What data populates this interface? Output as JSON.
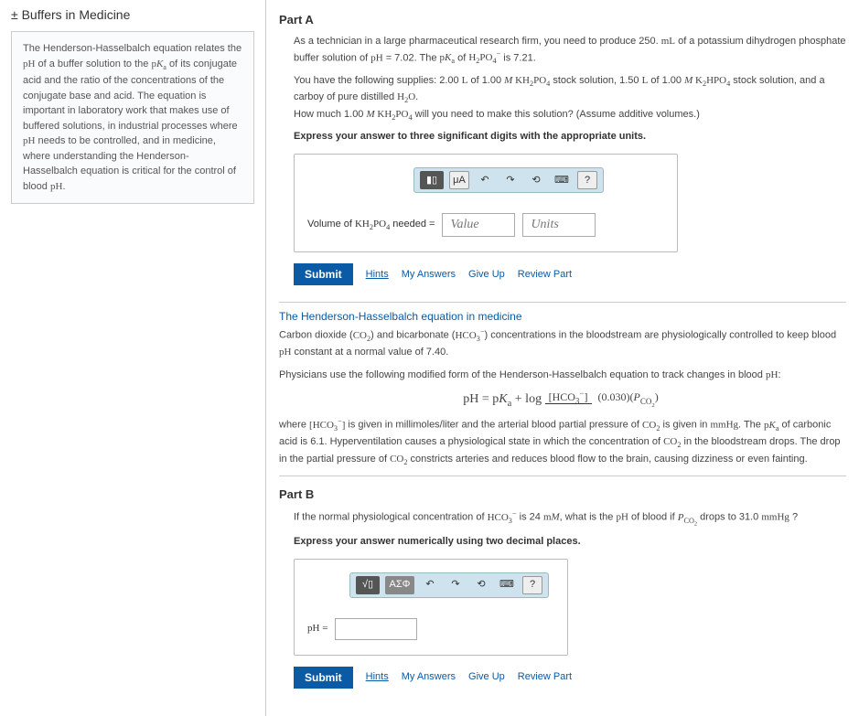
{
  "left": {
    "title": "± Buffers in Medicine",
    "box_html": "The Henderson-Hasselbalch equation relates the <span class='chem'>pH</span> of a buffer solution to the <span class='chem'>p<i>K</i><sub>a</sub></span> of its conjugate acid and the ratio of the concentrations of the conjugate base and acid. The equation is important in laboratory work that makes use of buffered solutions, in industrial processes where <span class='chem'>pH</span> needs to be controlled, and in medicine, where understanding the Henderson-Hasselbalch equation is critical for the control of blood <span class='chem'>pH</span>."
  },
  "partA": {
    "title": "Part A",
    "p1": "As a technician in a large pharmaceutical research firm, you need to produce 250. <span class='chem'>mL</span> of a potassium dihydrogen phosphate buffer solution of <span class='chem'>pH</span> = 7.02. The <span class='chem'>p<i>K</i><sub>a</sub></span> of <span class='chem'>H<sub>2</sub>PO<sub>4</sub><sup>−</sup></span> is 7.21.",
    "p2": "You have the following supplies: 2.00 <span class='chem'>L</span> of 1.00 <span class='chem'><i>M</i> KH<sub>2</sub>PO<sub>4</sub></span> stock solution, 1.50 <span class='chem'>L</span> of 1.00 <span class='chem'><i>M</i> K<sub>2</sub>HPO<sub>4</sub></span> stock solution, and a carboy of pure distilled <span class='chem'>H<sub>2</sub>O</span>.",
    "p3": "How much 1.00 <span class='chem'><i>M</i> KH<sub>2</sub>PO<sub>4</sub></span> will you need to make this solution? (Assume additive volumes.)",
    "bold": "Express your answer to three significant digits with the appropriate units.",
    "tool_mu": "μA",
    "tool_q": "?",
    "input_label": "Volume of <span class='chem'>KH<sub>2</sub>PO<sub>4</sub></span> needed =",
    "value_ph": "Value",
    "units_ph": "Units"
  },
  "hh": {
    "title": "The Henderson-Hasselbalch equation in medicine",
    "p1": "Carbon dioxide (<span class='chem'>CO<sub>2</sub></span>) and bicarbonate (<span class='chem'>HCO<sub>3</sub><sup>−</sup></span>) concentrations in the bloodstream are physiologically controlled to keep blood <span class='chem'>pH</span> constant at a normal value of 7.40.",
    "p2": "Physicians use the following modified form of the Henderson-Hasselbalch equation to track changes in blood <span class='chem'>pH</span>:",
    "eq_left": "pH = p<i>K</i><sub>a</sub> + log",
    "eq_num": "[HCO<sub>3</sub><sup>−</sup>]",
    "eq_den": "(0.030)(<i>P</i><sub>CO<sub>2</sub></sub>)",
    "p3": "where <span class='chem'>[HCO<sub>3</sub><sup>−</sup>]</span> is given in millimoles/liter and the arterial blood partial pressure of <span class='chem'>CO<sub>2</sub></span> is given in <span class='chem'>mmHg</span>. The <span class='chem'>p<i>K</i><sub>a</sub></span> of carbonic acid is 6.1. Hyperventilation causes a physiological state in which the concentration of <span class='chem'>CO<sub>2</sub></span> in the bloodstream drops. The drop in the partial pressure of <span class='chem'>CO<sub>2</sub></span> constricts arteries and reduces blood flow to the brain, causing dizziness or even fainting."
  },
  "partB": {
    "title": "Part B",
    "p1": "If the normal physiological concentration of <span class='chem'>HCO<sub>3</sub><sup>−</sup></span> is 24 <span class='chem'>m<i>M</i></span>, what is the <span class='chem'>pH</span> of blood if <span class='chem'><i>P</i><sub>CO<sub>2</sub></sub></span> drops to 31.0 <span class='chem'>mmHg</span> ?",
    "bold": "Express your answer numerically using two decimal places.",
    "tool_greek": "ΑΣΦ",
    "tool_q": "?",
    "input_label": "pH ="
  },
  "actions": {
    "submit": "Submit",
    "hints": "Hints",
    "myanswers": "My Answers",
    "giveup": "Give Up",
    "review": "Review Part"
  }
}
